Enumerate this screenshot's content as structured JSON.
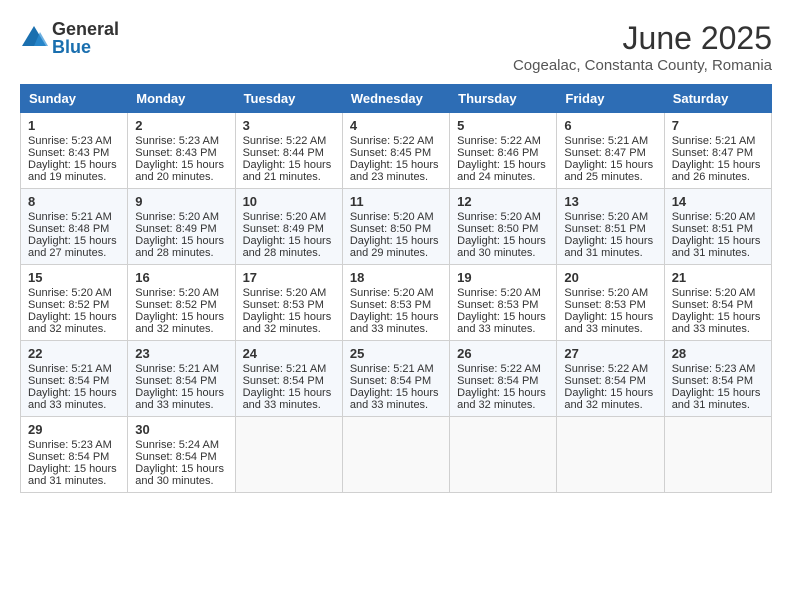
{
  "logo": {
    "general": "General",
    "blue": "Blue"
  },
  "title": "June 2025",
  "location": "Cogealac, Constanta County, Romania",
  "days_header": [
    "Sunday",
    "Monday",
    "Tuesday",
    "Wednesday",
    "Thursday",
    "Friday",
    "Saturday"
  ],
  "weeks": [
    [
      {
        "num": "1",
        "sr": "5:23 AM",
        "ss": "8:43 PM",
        "dl": "15 hours and 19 minutes."
      },
      {
        "num": "2",
        "sr": "5:23 AM",
        "ss": "8:43 PM",
        "dl": "15 hours and 20 minutes."
      },
      {
        "num": "3",
        "sr": "5:22 AM",
        "ss": "8:44 PM",
        "dl": "15 hours and 21 minutes."
      },
      {
        "num": "4",
        "sr": "5:22 AM",
        "ss": "8:45 PM",
        "dl": "15 hours and 23 minutes."
      },
      {
        "num": "5",
        "sr": "5:22 AM",
        "ss": "8:46 PM",
        "dl": "15 hours and 24 minutes."
      },
      {
        "num": "6",
        "sr": "5:21 AM",
        "ss": "8:47 PM",
        "dl": "15 hours and 25 minutes."
      },
      {
        "num": "7",
        "sr": "5:21 AM",
        "ss": "8:47 PM",
        "dl": "15 hours and 26 minutes."
      }
    ],
    [
      {
        "num": "8",
        "sr": "5:21 AM",
        "ss": "8:48 PM",
        "dl": "15 hours and 27 minutes."
      },
      {
        "num": "9",
        "sr": "5:20 AM",
        "ss": "8:49 PM",
        "dl": "15 hours and 28 minutes."
      },
      {
        "num": "10",
        "sr": "5:20 AM",
        "ss": "8:49 PM",
        "dl": "15 hours and 28 minutes."
      },
      {
        "num": "11",
        "sr": "5:20 AM",
        "ss": "8:50 PM",
        "dl": "15 hours and 29 minutes."
      },
      {
        "num": "12",
        "sr": "5:20 AM",
        "ss": "8:50 PM",
        "dl": "15 hours and 30 minutes."
      },
      {
        "num": "13",
        "sr": "5:20 AM",
        "ss": "8:51 PM",
        "dl": "15 hours and 31 minutes."
      },
      {
        "num": "14",
        "sr": "5:20 AM",
        "ss": "8:51 PM",
        "dl": "15 hours and 31 minutes."
      }
    ],
    [
      {
        "num": "15",
        "sr": "5:20 AM",
        "ss": "8:52 PM",
        "dl": "15 hours and 32 minutes."
      },
      {
        "num": "16",
        "sr": "5:20 AM",
        "ss": "8:52 PM",
        "dl": "15 hours and 32 minutes."
      },
      {
        "num": "17",
        "sr": "5:20 AM",
        "ss": "8:53 PM",
        "dl": "15 hours and 32 minutes."
      },
      {
        "num": "18",
        "sr": "5:20 AM",
        "ss": "8:53 PM",
        "dl": "15 hours and 33 minutes."
      },
      {
        "num": "19",
        "sr": "5:20 AM",
        "ss": "8:53 PM",
        "dl": "15 hours and 33 minutes."
      },
      {
        "num": "20",
        "sr": "5:20 AM",
        "ss": "8:53 PM",
        "dl": "15 hours and 33 minutes."
      },
      {
        "num": "21",
        "sr": "5:20 AM",
        "ss": "8:54 PM",
        "dl": "15 hours and 33 minutes."
      }
    ],
    [
      {
        "num": "22",
        "sr": "5:21 AM",
        "ss": "8:54 PM",
        "dl": "15 hours and 33 minutes."
      },
      {
        "num": "23",
        "sr": "5:21 AM",
        "ss": "8:54 PM",
        "dl": "15 hours and 33 minutes."
      },
      {
        "num": "24",
        "sr": "5:21 AM",
        "ss": "8:54 PM",
        "dl": "15 hours and 33 minutes."
      },
      {
        "num": "25",
        "sr": "5:21 AM",
        "ss": "8:54 PM",
        "dl": "15 hours and 33 minutes."
      },
      {
        "num": "26",
        "sr": "5:22 AM",
        "ss": "8:54 PM",
        "dl": "15 hours and 32 minutes."
      },
      {
        "num": "27",
        "sr": "5:22 AM",
        "ss": "8:54 PM",
        "dl": "15 hours and 32 minutes."
      },
      {
        "num": "28",
        "sr": "5:23 AM",
        "ss": "8:54 PM",
        "dl": "15 hours and 31 minutes."
      }
    ],
    [
      {
        "num": "29",
        "sr": "5:23 AM",
        "ss": "8:54 PM",
        "dl": "15 hours and 31 minutes."
      },
      {
        "num": "30",
        "sr": "5:24 AM",
        "ss": "8:54 PM",
        "dl": "15 hours and 30 minutes."
      },
      null,
      null,
      null,
      null,
      null
    ]
  ],
  "labels": {
    "sunrise": "Sunrise:",
    "sunset": "Sunset:",
    "daylight": "Daylight: 15 hours"
  }
}
